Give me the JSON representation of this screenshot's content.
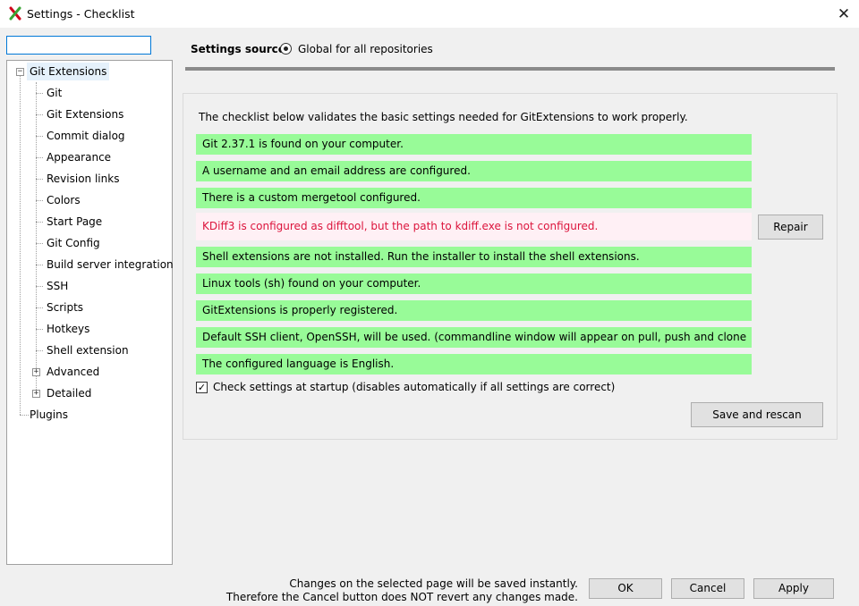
{
  "window": {
    "title": "Settings - Checklist",
    "close_glyph": "✕",
    "app_icon": "git-extensions-logo",
    "colors": {
      "logo_red": "#d0021b",
      "logo_green": "#3aa535"
    }
  },
  "search": {
    "value": "",
    "placeholder": ""
  },
  "tree": {
    "root": {
      "label": "Git Extensions",
      "expander": "−"
    },
    "children": [
      {
        "label": "Git"
      },
      {
        "label": "Git Extensions"
      },
      {
        "label": "Commit dialog"
      },
      {
        "label": "Appearance"
      },
      {
        "label": "Revision links"
      },
      {
        "label": "Colors"
      },
      {
        "label": "Start Page"
      },
      {
        "label": "Git Config"
      },
      {
        "label": "Build server integration"
      },
      {
        "label": "SSH"
      },
      {
        "label": "Scripts"
      },
      {
        "label": "Hotkeys"
      },
      {
        "label": "Shell extension"
      },
      {
        "label": "Advanced",
        "expander": "+"
      },
      {
        "label": "Detailed",
        "expander": "+"
      }
    ],
    "plugins": {
      "label": "Plugins"
    },
    "selected_color": "#e5f1fb"
  },
  "settings_source": {
    "label": "Settings source:",
    "option": "Global for all repositories",
    "selected": true
  },
  "checklist": {
    "intro": "The checklist below validates the basic settings needed for GitExtensions to work properly.",
    "items": [
      {
        "text": "Git 2.37.1 is found on your computer.",
        "status": "ok"
      },
      {
        "text": "A username and an email address are configured.",
        "status": "ok"
      },
      {
        "text": "There is a custom mergetool configured.",
        "status": "ok"
      },
      {
        "text": "KDiff3 is configured as difftool, but the path to kdiff.exe is not configured.",
        "status": "warn"
      },
      {
        "text": "Shell extensions are not installed. Run the installer to install the shell extensions.",
        "status": "ok"
      },
      {
        "text": "Linux tools (sh) found on your computer.",
        "status": "ok"
      },
      {
        "text": "GitExtensions is properly registered.",
        "status": "ok"
      },
      {
        "text": "Default SSH client, OpenSSH, will be used. (commandline window will appear on pull, push and clone",
        "status": "ok"
      },
      {
        "text": "The configured language is English.",
        "status": "ok"
      }
    ],
    "repair_label": "Repair",
    "startup_check": {
      "label": "Check settings at startup (disables automatically if all settings are correct)",
      "checked": true,
      "glyph": "✓"
    },
    "save_rescan_label": "Save and rescan",
    "colors": {
      "ok_bg": "#98fb98",
      "warn_bg": "#fff0f5",
      "warn_text": "#dc143c"
    }
  },
  "footer": {
    "note_line1": "Changes on the selected page will be saved instantly.",
    "note_line2": "Therefore the Cancel button does NOT revert any changes made.",
    "ok_label": "OK",
    "cancel_label": "Cancel",
    "apply_label": "Apply"
  }
}
